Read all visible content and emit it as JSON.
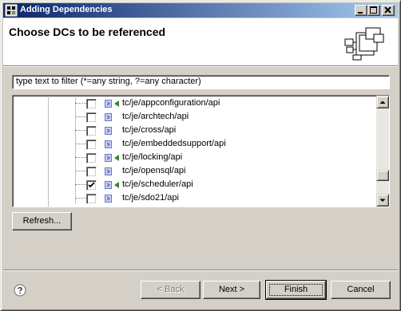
{
  "window": {
    "title": "Adding Dependencies"
  },
  "banner": {
    "title": "Choose DCs to be referenced"
  },
  "filter": {
    "value": "type text to filter (*=any string, ?=any character)"
  },
  "tree": {
    "items": [
      {
        "label": "tc/je/appconfiguration/api",
        "checked": false,
        "has_arrow": true
      },
      {
        "label": "tc/je/archtech/api",
        "checked": false,
        "has_arrow": false
      },
      {
        "label": "tc/je/cross/api",
        "checked": false,
        "has_arrow": false
      },
      {
        "label": "tc/je/embeddedsupport/api",
        "checked": false,
        "has_arrow": false
      },
      {
        "label": "tc/je/locking/api",
        "checked": false,
        "has_arrow": true
      },
      {
        "label": "tc/je/opensql/api",
        "checked": false,
        "has_arrow": false
      },
      {
        "label": "tc/je/scheduler/api",
        "checked": true,
        "has_arrow": true
      },
      {
        "label": "tc/je/sdo21/api",
        "checked": false,
        "has_arrow": false
      }
    ]
  },
  "buttons": {
    "refresh": "Refresh...",
    "back": "< Back",
    "next": "Next >",
    "finish": "Finish",
    "cancel": "Cancel"
  },
  "icons": {
    "title": "app-icon",
    "banner": "dependency-icon",
    "help": "help-icon",
    "dc": "dc-icon"
  },
  "colors": {
    "titlebar_start": "#0a246a",
    "titlebar_end": "#a6caf0",
    "arrow_green": "#2e8b2e",
    "dc_icon": "#6a78c8"
  }
}
